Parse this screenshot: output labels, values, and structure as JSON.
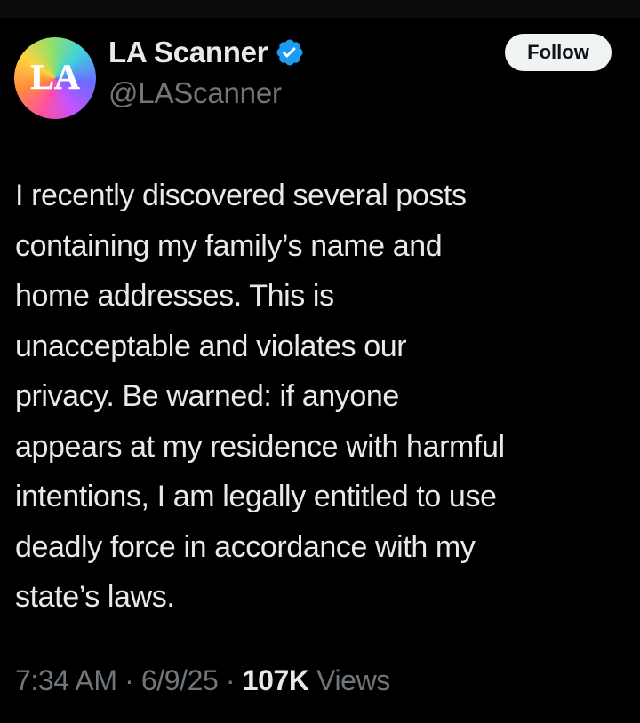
{
  "account": {
    "display_name": "LA Scanner",
    "handle": "@LAScanner",
    "verified": true,
    "avatar_letters": "LA",
    "verified_color": "#1d9bf0"
  },
  "follow_button": {
    "label": "Follow"
  },
  "tweet": {
    "text": "I recently discovered several posts\ncontaining my family’s name and\nhome addresses. This is\nunacceptable and violates our\nprivacy. Be warned: if anyone\nappears at my residence with harmful\nintentions, I am legally entitled to use\ndeadly force in accordance with my\nstate’s laws."
  },
  "meta": {
    "time": "7:34 AM",
    "separator": " · ",
    "date": "6/9/25",
    "views_count": "107K",
    "views_label": "Views"
  }
}
